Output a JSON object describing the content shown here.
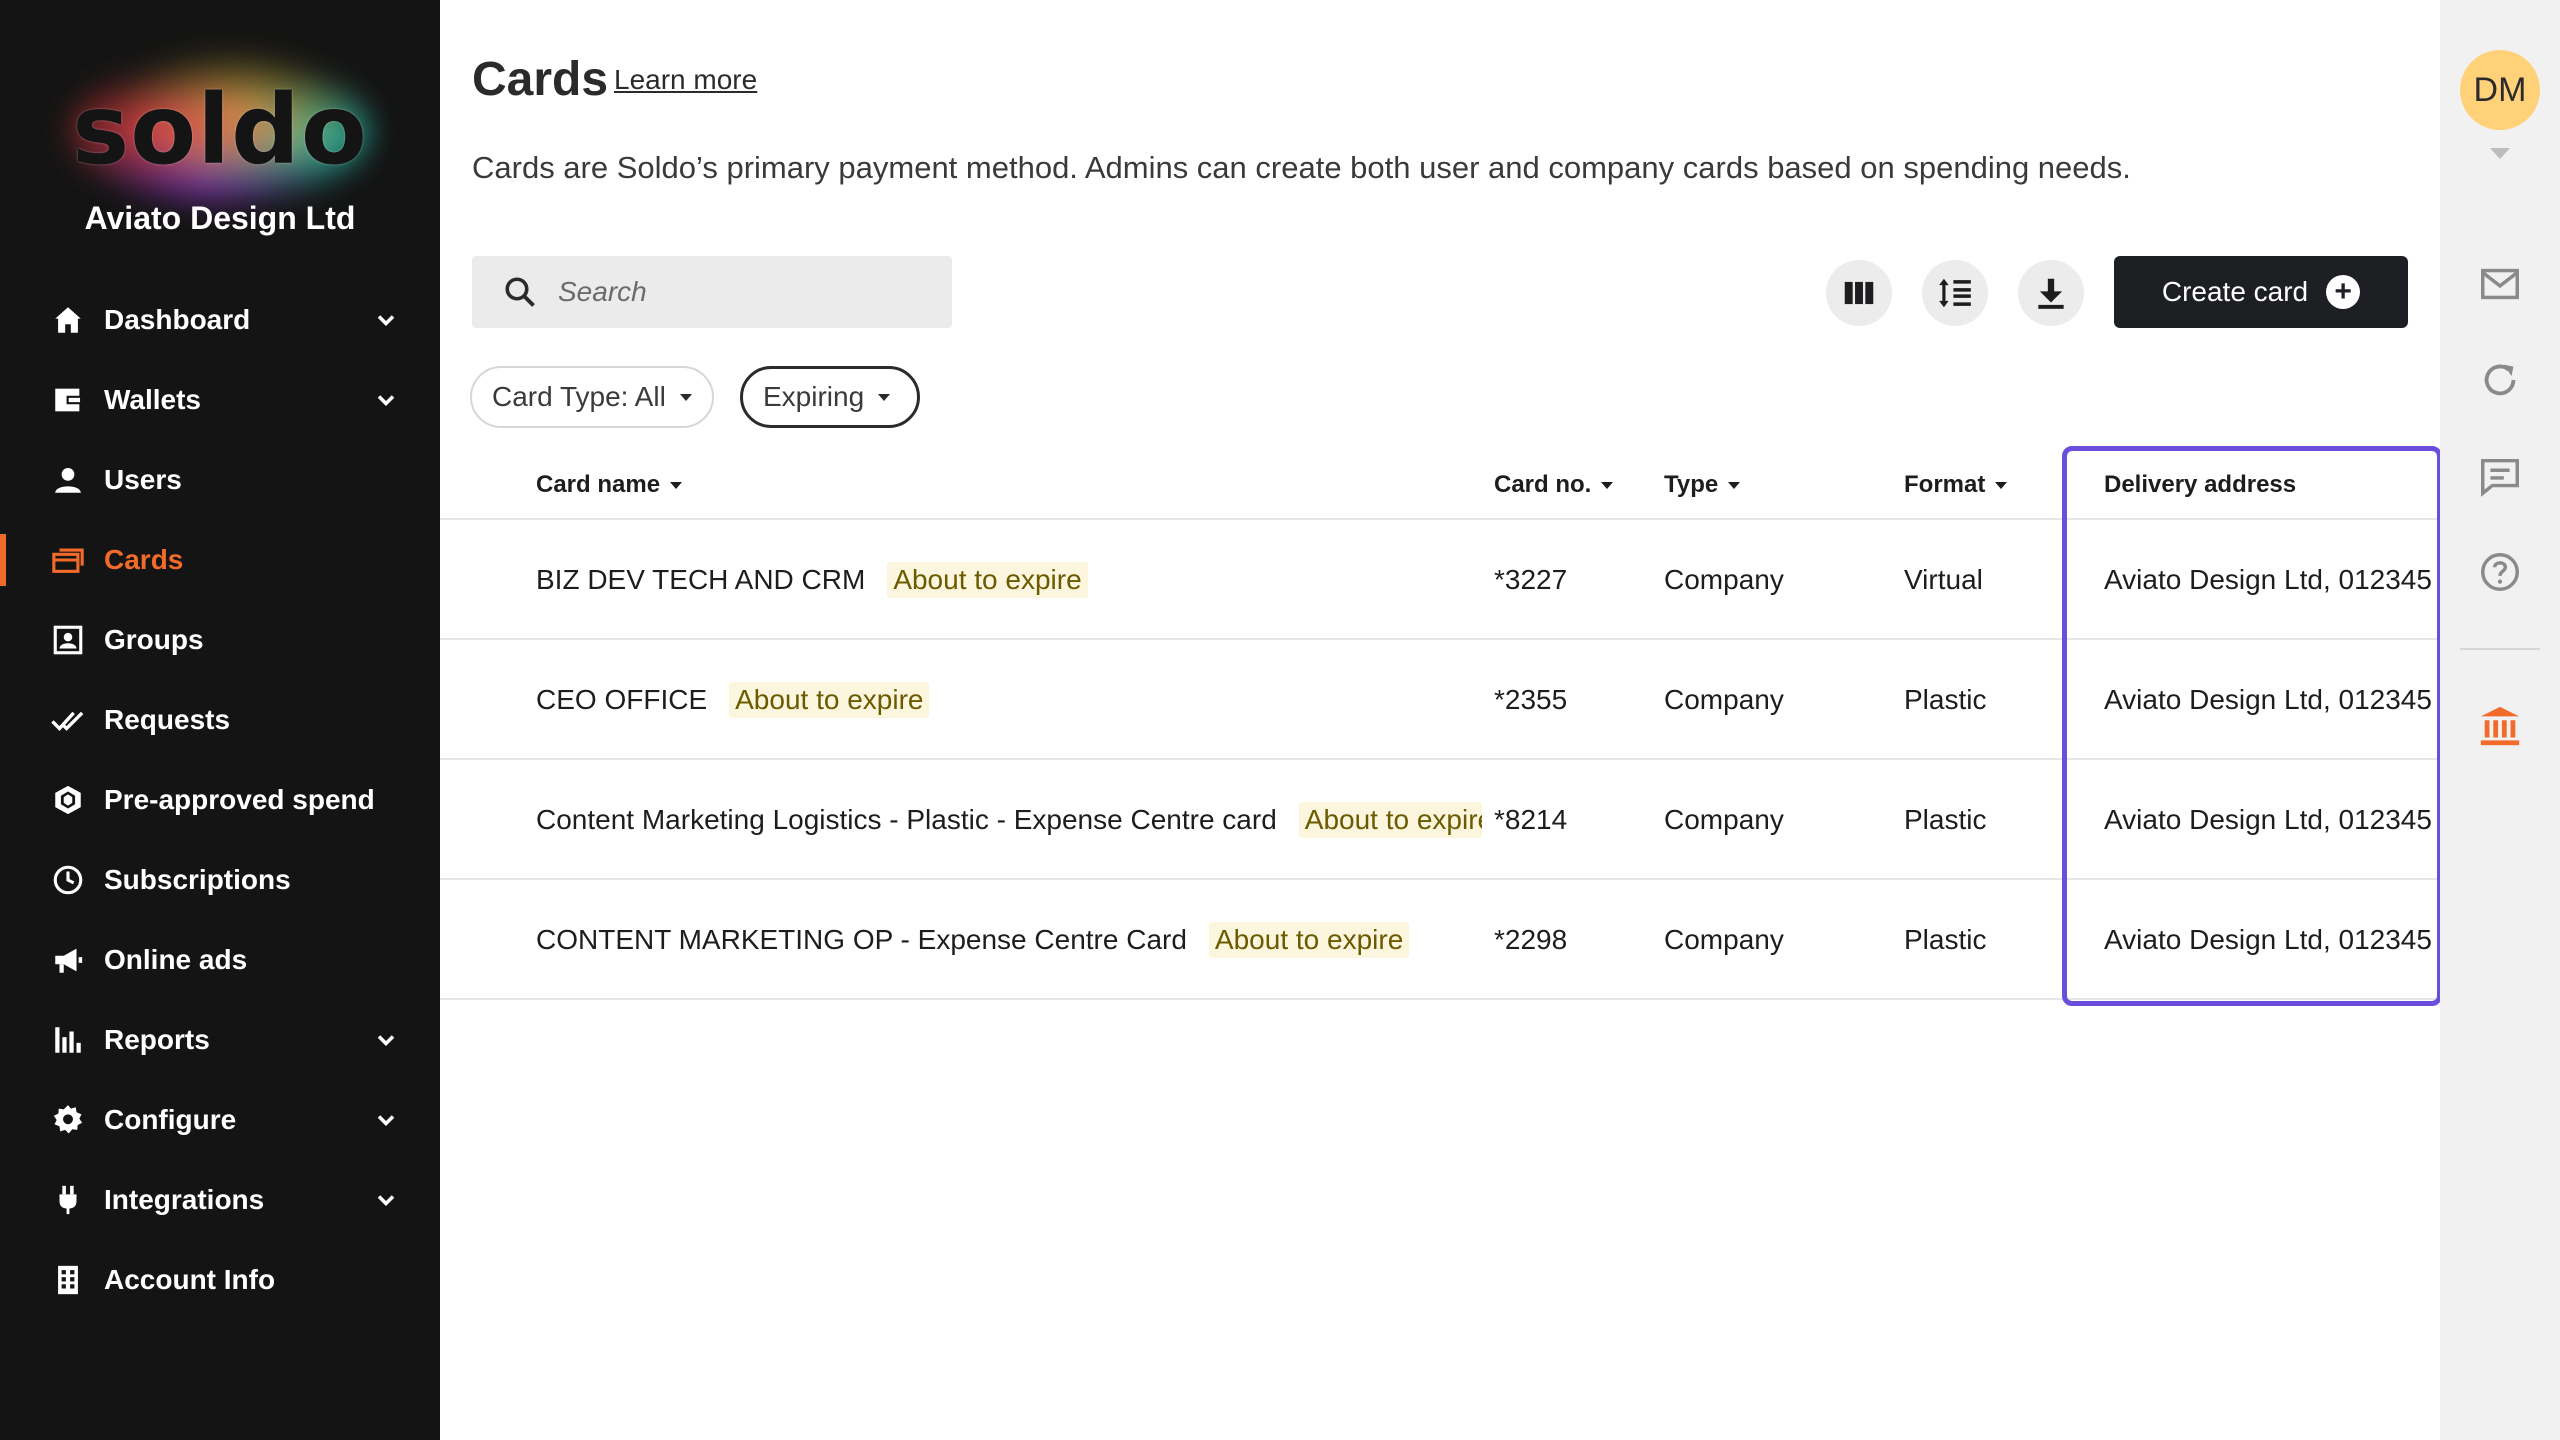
{
  "brand": {
    "logo_text": "soldo",
    "company": "Aviato Design Ltd",
    "accent": "#f26b2a"
  },
  "nav": {
    "items": [
      {
        "label": "Dashboard",
        "icon": "home-icon",
        "expandable": true
      },
      {
        "label": "Wallets",
        "icon": "wallet-icon",
        "expandable": true
      },
      {
        "label": "Users",
        "icon": "user-icon",
        "expandable": false
      },
      {
        "label": "Cards",
        "icon": "cards-icon",
        "expandable": false,
        "active": true
      },
      {
        "label": "Groups",
        "icon": "groups-icon",
        "expandable": false
      },
      {
        "label": "Requests",
        "icon": "double-check-icon",
        "expandable": false
      },
      {
        "label": "Pre-approved spend",
        "icon": "hexagon-icon",
        "expandable": false
      },
      {
        "label": "Subscriptions",
        "icon": "clock-icon",
        "expandable": false
      },
      {
        "label": "Online ads",
        "icon": "megaphone-icon",
        "expandable": false
      },
      {
        "label": "Reports",
        "icon": "bar-chart-icon",
        "expandable": true
      },
      {
        "label": "Configure",
        "icon": "gear-icon",
        "expandable": true
      },
      {
        "label": "Integrations",
        "icon": "plug-icon",
        "expandable": true
      },
      {
        "label": "Account Info",
        "icon": "building-icon",
        "expandable": false
      }
    ]
  },
  "header": {
    "title": "Cards",
    "learn_more": "Learn more",
    "description": "Cards are Soldo’s primary payment method. Admins can create both user and company cards based on spending needs."
  },
  "toolbar": {
    "search_placeholder": "Search",
    "create_label": "Create card",
    "columns_icon": "columns-icon",
    "density_icon": "line-spacing-icon",
    "download_icon": "download-icon"
  },
  "filters": {
    "card_type": "Card Type: All",
    "expiring": "Expiring"
  },
  "table": {
    "headers": {
      "name": "Card name",
      "number": "Card no.",
      "type": "Type",
      "format": "Format",
      "address": "Delivery address"
    },
    "rows": [
      {
        "name": "BIZ DEV TECH AND CRM",
        "badge": "About to expire",
        "number": "*3227",
        "type": "Company",
        "format": "Virtual",
        "address": "Aviato Design Ltd, 012345,"
      },
      {
        "name": "CEO OFFICE",
        "badge": "About to expire",
        "number": "*2355",
        "type": "Company",
        "format": "Plastic",
        "address": "Aviato Design Ltd, 012345,"
      },
      {
        "name": "Content Marketing Logistics - Plastic - Expense Centre card",
        "badge": "About to expire",
        "number": "*8214",
        "type": "Company",
        "format": "Plastic",
        "address": "Aviato Design Ltd, 012345,"
      },
      {
        "name": "CONTENT MARKETING OP - Expense Centre Card",
        "badge": "About to expire",
        "number": "*2298",
        "type": "Company",
        "format": "Plastic",
        "address": "Aviato Design Ltd, 012345,"
      }
    ]
  },
  "rail": {
    "avatar_initials": "DM",
    "avatar_color": "#ffd27a",
    "highlight_color": "#6b4fdc",
    "icons": [
      "mail-icon",
      "refresh-icon",
      "chat-icon",
      "help-icon",
      "bank-icon"
    ]
  }
}
